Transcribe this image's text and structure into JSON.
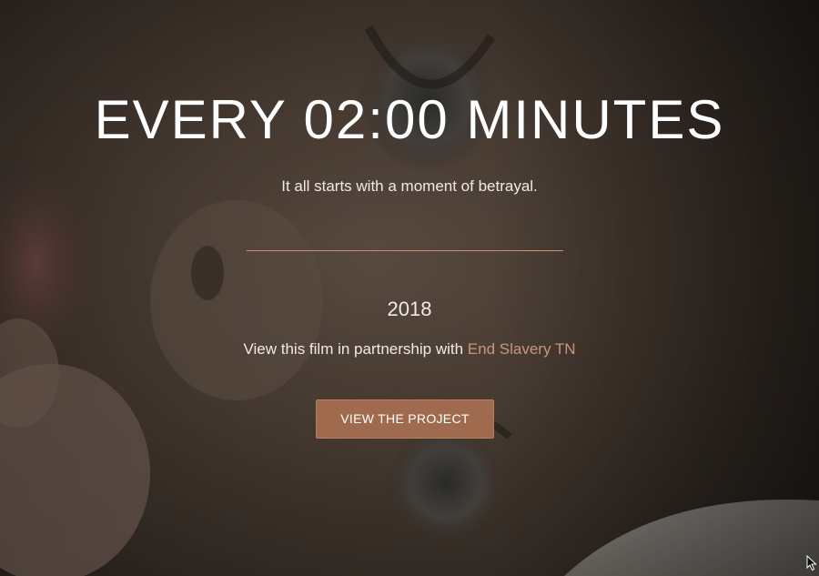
{
  "hero": {
    "title": "EVERY 02:00 MINUTES",
    "tagline": "It all starts with a moment of betrayal.",
    "year": "2018",
    "partner_prefix": "View this film in partnership with ",
    "partner_link": "End Slavery TN",
    "cta_label": "VIEW THE PROJECT"
  },
  "colors": {
    "accent": "#c7967a",
    "button": "#a06a4e",
    "text": "#ffffff",
    "overlay": "#2b2621"
  },
  "icons": {
    "cursor": "mouse-pointer-icon"
  }
}
